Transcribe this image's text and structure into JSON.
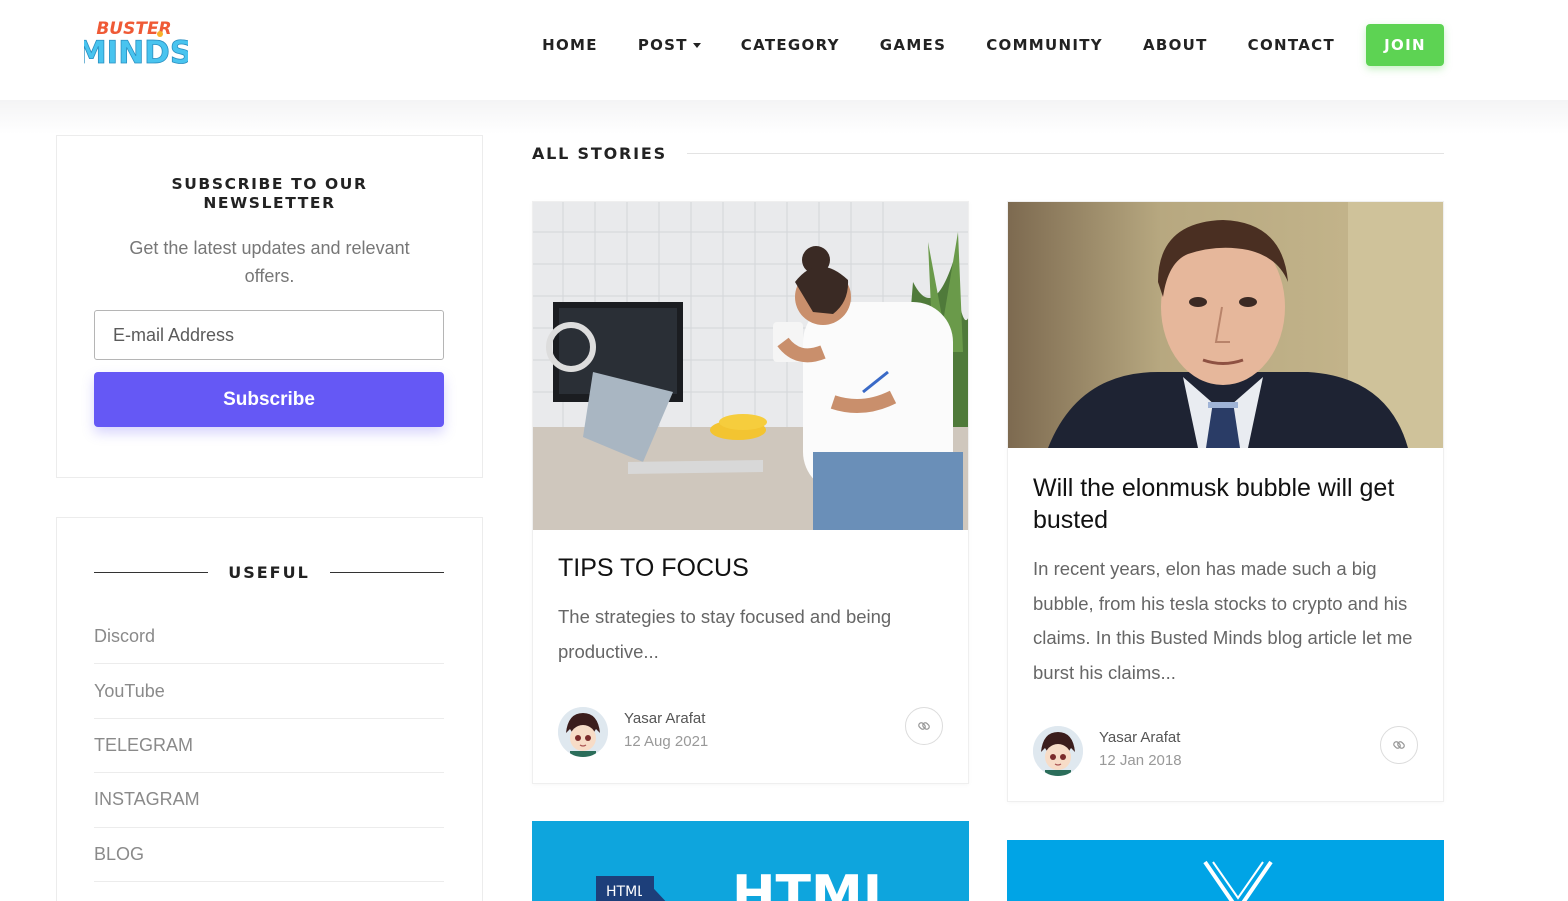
{
  "brand": {
    "logo_top": "BUSTER",
    "logo_bottom": "MINDS"
  },
  "nav": {
    "items": [
      "HOME",
      "POST",
      "CATEGORY",
      "GAMES",
      "COMMUNITY",
      "ABOUT",
      "CONTACT"
    ],
    "join_label": "JOIN",
    "caret_icon": "caret-down-icon"
  },
  "newsletter": {
    "title": "SUBSCRIBE TO OUR NEWSLETTER",
    "subtitle": "Get the latest updates and relevant offers.",
    "email_placeholder": "E-mail Address",
    "button_label": "Subscribe"
  },
  "useful": {
    "title": "USEFUL",
    "links": [
      "Discord",
      "YouTube",
      "TELEGRAM",
      "INSTAGRAM",
      "BLOG"
    ]
  },
  "stories": {
    "heading": "ALL STORIES",
    "posts": [
      {
        "title": "TIPS TO FOCUS",
        "excerpt": "The strategies to stay focused and being productive...",
        "author": "Yasar Arafat",
        "date": "12 Aug 2021",
        "icon": "link-icon"
      },
      {
        "title": "Will the elonmusk bubble will get busted",
        "excerpt": "In recent years, elon has made such a big bubble, from his tesla stocks to crypto and his claims. In this Busted Minds blog article let me burst his claims...",
        "author": "Yasar Arafat",
        "date": "12 Jan 2018",
        "icon": "link-icon"
      }
    ],
    "bottom_cards": [
      {
        "badge": "HTML",
        "big_text": "HTML"
      },
      {
        "icon": "v-chevron-icon"
      }
    ]
  },
  "colors": {
    "join_green": "#5dd353",
    "subscribe_purple": "#6558f5",
    "html_blue": "#0ea5dd",
    "v_blue": "#00a4e6"
  }
}
